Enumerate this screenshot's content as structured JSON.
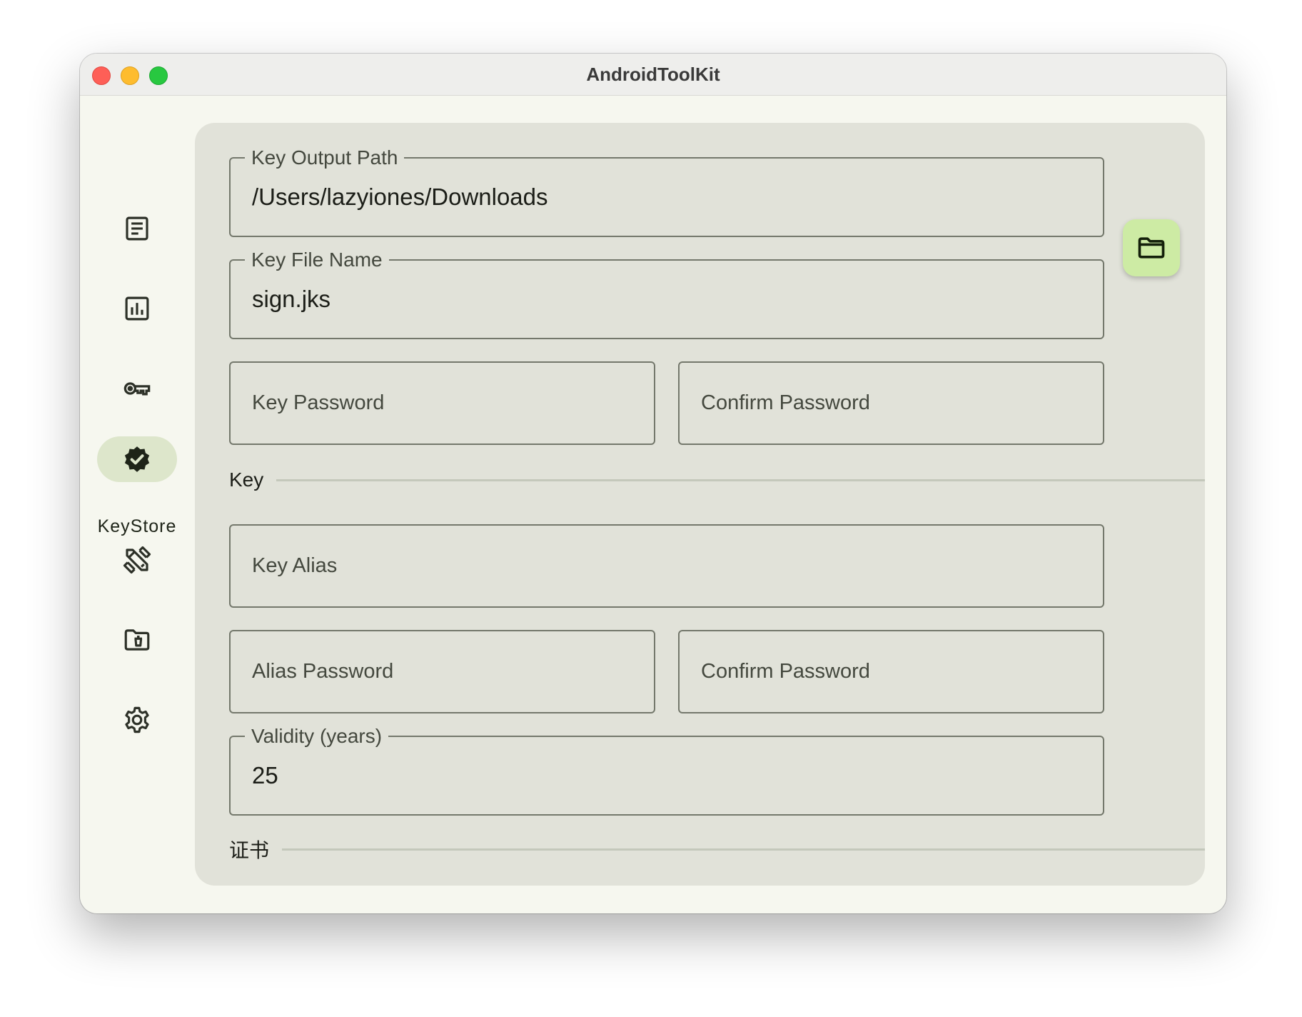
{
  "window": {
    "title": "AndroidToolKit"
  },
  "sidebar": {
    "items": [
      {
        "icon": "document-icon",
        "label": ""
      },
      {
        "icon": "chart-icon",
        "label": ""
      },
      {
        "icon": "key-icon",
        "label": ""
      },
      {
        "icon": "verified-badge-icon",
        "label": "KeyStore",
        "active": true
      },
      {
        "icon": "tools-icon",
        "label": ""
      },
      {
        "icon": "folder-delete-icon",
        "label": ""
      },
      {
        "icon": "gear-icon",
        "label": ""
      }
    ]
  },
  "form": {
    "output_path": {
      "label": "Key Output Path",
      "value": "/Users/lazyiones/Downloads"
    },
    "folder_button": {
      "icon": "folder-icon"
    },
    "file_name": {
      "label": "Key File Name",
      "value": "sign.jks"
    },
    "key_password": {
      "placeholder": "Key Password"
    },
    "key_password_confirm": {
      "placeholder": "Confirm Password"
    },
    "section_key": "Key",
    "key_alias": {
      "placeholder": "Key Alias"
    },
    "alias_password": {
      "placeholder": "Alias Password"
    },
    "alias_password_confirm": {
      "placeholder": "Confirm Password"
    },
    "validity": {
      "label": "Validity (years)",
      "value": "25"
    },
    "section_cert": "证书"
  },
  "colors": {
    "accent_container": "#cdeba4",
    "nav_active": "#dde6cb",
    "panel_bg": "#e1e2d9",
    "window_bg": "#f6f7ef"
  }
}
